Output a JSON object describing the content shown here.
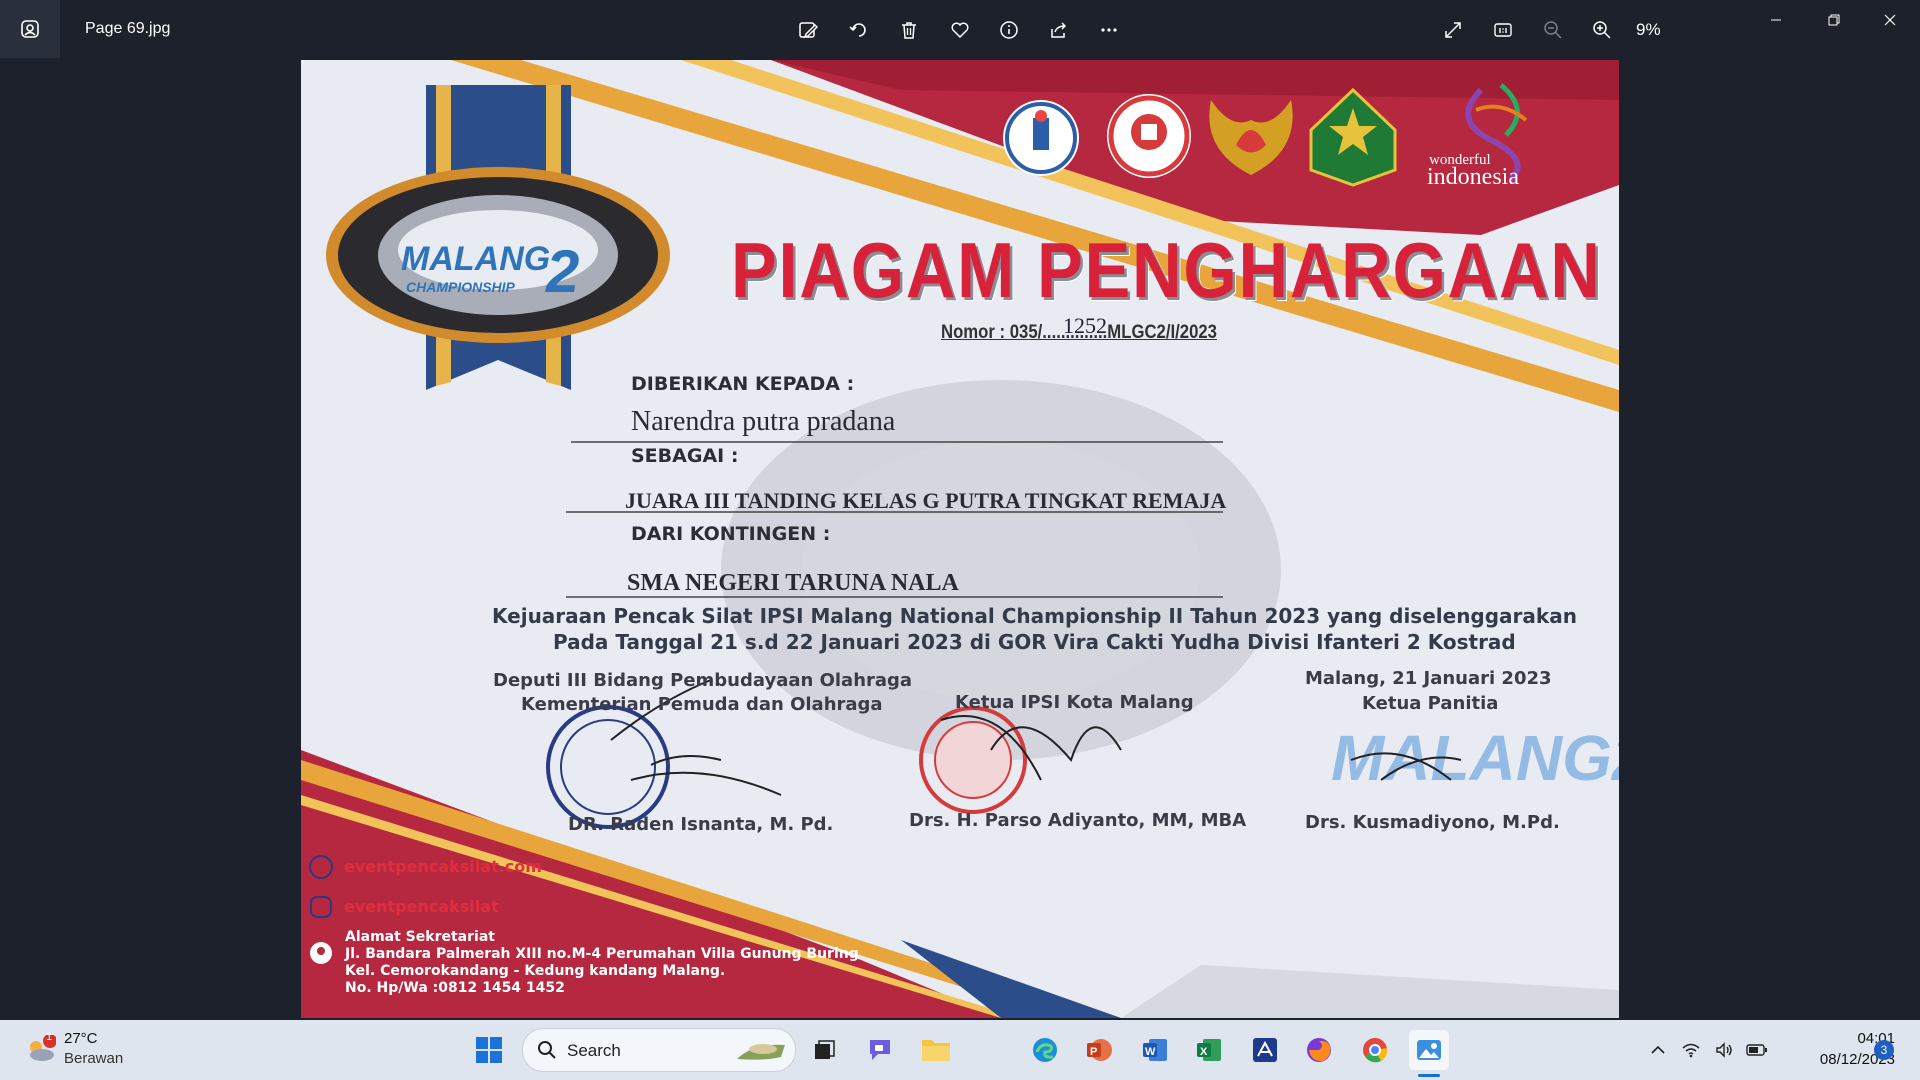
{
  "viewer": {
    "file_name": "Page 69.jpg",
    "zoom_level": "9%",
    "toolbar_icons": [
      "edit-image-icon",
      "rotate-icon",
      "delete-icon",
      "favorite-icon",
      "info-icon",
      "share-icon",
      "more-icon"
    ],
    "right_icons": [
      "fullscreen-icon",
      "actual-size-icon",
      "zoom-out-icon",
      "zoom-in-icon"
    ],
    "window_controls": [
      "minimize-icon",
      "restore-icon",
      "close-icon"
    ]
  },
  "certificate": {
    "brand_logo_text": "IPSI MALANG CHAMPIONSHIP 2",
    "partner_logos": [
      "kemenpora-logo",
      "ipsi-logo",
      "koni-logo",
      "malang-city-logo",
      "wonderful-indonesia-logo"
    ],
    "wonderful_small": "wonderful",
    "wonderful_big": "indonesia",
    "title": "PIAGAM PENGHARGAAN",
    "nomor": "Nomor : 035/..............MLGC2/I/2023",
    "nomor_handwritten": "1252",
    "label_given_to": "DIBERIKAN KEPADA :",
    "recipient": "Narendra putra pradana",
    "label_as": "SEBAGAI :",
    "achievement": "JUARA III TANDING KELAS G PUTRA TINGKAT REMAJA",
    "label_contingent": "DARI KONTINGEN :",
    "contingent": "SMA NEGERI TARUNA NALA",
    "event_line1": "Kejuaraan Pencak Silat  IPSI Malang National Championship II Tahun 2023 yang diselenggarakan",
    "event_line2": "Pada Tanggal 21 s.d 22 Januari 2023 di GOR Vira Cakti Yudha Divisi Ifanteri 2 Kostrad",
    "sig1_role1": "Deputi III Bidang Pembudayaan Olahraga",
    "sig1_role2": "Kementerian Pemuda dan Olahraga",
    "sig1_name": "DR. Raden Isnanta, M. Pd.",
    "sig2_role": "Ketua IPSI Kota Malang",
    "sig2_name": "Drs. H. Parso Adiyanto, MM, MBA",
    "sig3_place_date": "Malang, 21 Januari 2023",
    "sig3_role": "Ketua Panitia",
    "sig3_name": "Drs. Kusmadiyono, M.Pd.",
    "website": "eventpencaksilat.com",
    "instagram": "eventpencaksilat",
    "address_title": "Alamat Sekretariat",
    "address_line1": "Jl. Bandara Palmerah XIII no.M-4 Perumahan Villa Gunung Buring",
    "address_line2": "Kel. Cemorokandang - Kedung kandang Malang.",
    "address_line3": "No. Hp/Wa :0812 1454 1452",
    "colors": {
      "red": "#d7223a",
      "navy": "#1f3f7a",
      "gold": "#e8a93a"
    }
  },
  "taskbar": {
    "weather_temp": "27°C",
    "weather_desc": "Berawan",
    "weather_badge": "1",
    "search_placeholder": "Search",
    "apps": [
      "start-icon",
      "task-view-icon",
      "chat-icon",
      "file-explorer-icon",
      "edge-icon",
      "powerpoint-icon",
      "word-icon",
      "excel-icon",
      "app-icon",
      "firefox-icon",
      "chrome-icon",
      "photos-icon"
    ],
    "tray_icons": [
      "chevron-up-icon",
      "wifi-icon",
      "volume-icon",
      "battery-icon"
    ],
    "time": "04:01",
    "date": "08/12/2023",
    "notification_count": "3"
  }
}
